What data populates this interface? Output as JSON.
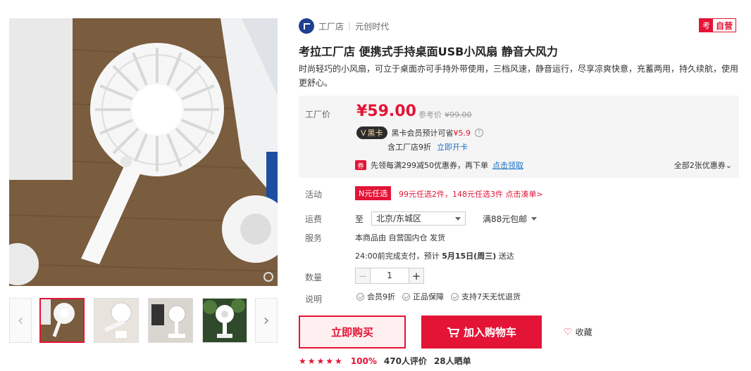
{
  "shop": {
    "name": "工厂店",
    "separator": "|",
    "brand": "元创时代"
  },
  "badge": {
    "icon": "考",
    "label": "自营"
  },
  "product": {
    "title": "考拉工厂店 便携式手持桌面USB小风扇 静音大风力",
    "description": "时尚轻巧的小风扇，可立于桌面亦可手持外带使用，三档风速，静音运行，尽享凉爽快意，充蓄两用，持久续航，使用更舒心。"
  },
  "price": {
    "label": "工厂价",
    "value": "¥59.00",
    "ref_label": "参考价",
    "ref_value": "¥99.00",
    "vip_tag": "黑卡",
    "vip_text": "黑卡会员预计可省",
    "vip_save": "¥5.9",
    "vip_sub": "含工厂店9折",
    "vip_link": "立即开卡",
    "coupon_icon": "券",
    "coupon_text": "先领每满299减50优惠券，再下单",
    "coupon_link": "点击领取",
    "all_coupons": "全部2张优惠券"
  },
  "activity": {
    "label": "活动",
    "tag": "N元任选",
    "text": "99元任选2件，148元任选3件 点击凑单>"
  },
  "shipping": {
    "label": "运费",
    "to": "至",
    "region": "北京/东城区",
    "free": "满88元包邮"
  },
  "service": {
    "label": "服务",
    "line1": "本商品由 自营国内仓 发货",
    "line2_prefix": "24:00前完成支付，预计",
    "line2_date": "5月15日(周三)",
    "line2_suffix": "送达"
  },
  "quantity": {
    "label": "数量",
    "value": "1",
    "minus": "−",
    "plus": "+"
  },
  "notes": {
    "label": "说明",
    "items": [
      "会员9折",
      "正品保障",
      "支持7天无忧退货"
    ]
  },
  "actions": {
    "buy_now": "立即购买",
    "add_cart": "加入购物车",
    "favorite": "收藏"
  },
  "rating": {
    "stars": "★★★★★",
    "percent": "100%",
    "reviews": "470人评价",
    "shows": "28人晒单"
  },
  "gallery": {
    "left_arrow": "‹",
    "right_arrow": "›"
  }
}
